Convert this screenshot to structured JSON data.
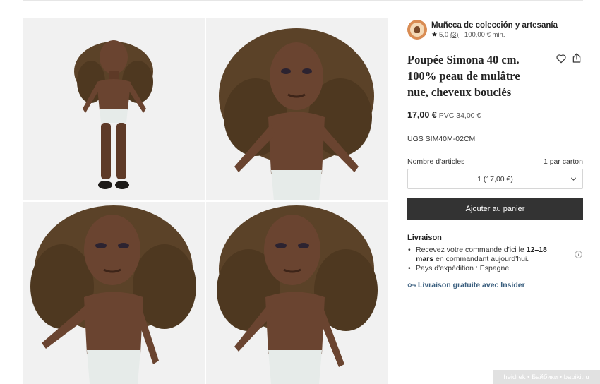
{
  "shop": {
    "name": "Muñeca de colección y artesanía",
    "rating": "5,0",
    "reviews": "(3)",
    "separator": "·",
    "minimum": "100,00 € min."
  },
  "product": {
    "title": "Poupée Simona 40 cm. 100% peau de mulâtre nue, cheveux bouclés",
    "price": "17,00 €",
    "original_price": "PVC 34,00 €",
    "sku": "UGS SIM40M-02CM"
  },
  "quantity": {
    "label": "Nombre d'articles",
    "per_carton": "1 par carton",
    "selected": "1 (17,00 €)"
  },
  "actions": {
    "add_to_cart": "Ajouter au panier"
  },
  "delivery": {
    "title": "Livraison",
    "line1_pre": "Recevez votre commande d'ici le ",
    "line1_bold": "12–18 mars",
    "line1_post": " en commandant aujourd'hui.",
    "line2": "Pays d'expédition : Espagne",
    "insider": "Livraison gratuite avec Insider"
  },
  "watermark": "heidrek • Байбики • babiki.ru",
  "icons": {
    "favorite": "heart-icon",
    "share": "share-icon",
    "dropdown": "chevron-down-icon",
    "info": "info-icon",
    "key": "key-icon",
    "star": "star-icon"
  },
  "colors": {
    "button": "#333333",
    "link": "#3b5f7f",
    "tile_bg": "#f1f1f1"
  }
}
